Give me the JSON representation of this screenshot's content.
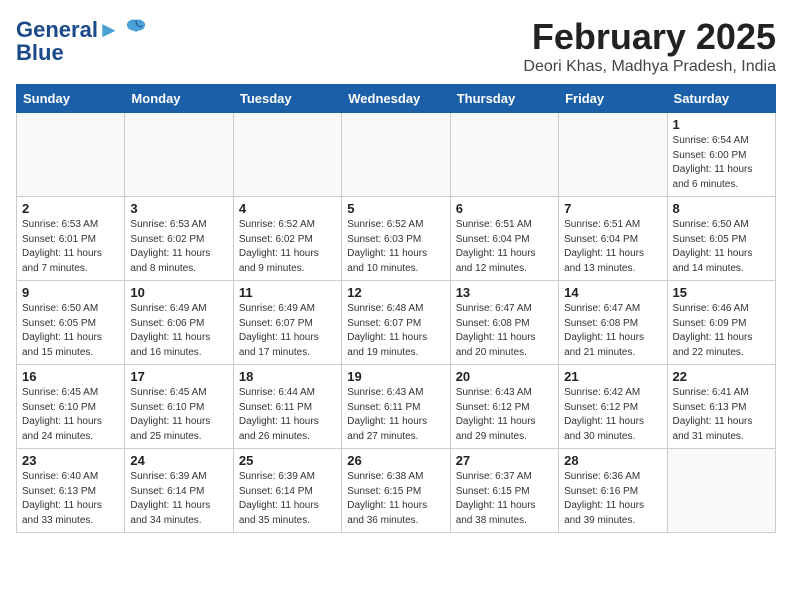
{
  "header": {
    "logo_line1": "General",
    "logo_line2": "Blue",
    "title": "February 2025",
    "subtitle": "Deori Khas, Madhya Pradesh, India"
  },
  "weekdays": [
    "Sunday",
    "Monday",
    "Tuesday",
    "Wednesday",
    "Thursday",
    "Friday",
    "Saturday"
  ],
  "weeks": [
    [
      {
        "day": "",
        "info": ""
      },
      {
        "day": "",
        "info": ""
      },
      {
        "day": "",
        "info": ""
      },
      {
        "day": "",
        "info": ""
      },
      {
        "day": "",
        "info": ""
      },
      {
        "day": "",
        "info": ""
      },
      {
        "day": "1",
        "info": "Sunrise: 6:54 AM\nSunset: 6:00 PM\nDaylight: 11 hours\nand 6 minutes."
      }
    ],
    [
      {
        "day": "2",
        "info": "Sunrise: 6:53 AM\nSunset: 6:01 PM\nDaylight: 11 hours\nand 7 minutes."
      },
      {
        "day": "3",
        "info": "Sunrise: 6:53 AM\nSunset: 6:02 PM\nDaylight: 11 hours\nand 8 minutes."
      },
      {
        "day": "4",
        "info": "Sunrise: 6:52 AM\nSunset: 6:02 PM\nDaylight: 11 hours\nand 9 minutes."
      },
      {
        "day": "5",
        "info": "Sunrise: 6:52 AM\nSunset: 6:03 PM\nDaylight: 11 hours\nand 10 minutes."
      },
      {
        "day": "6",
        "info": "Sunrise: 6:51 AM\nSunset: 6:04 PM\nDaylight: 11 hours\nand 12 minutes."
      },
      {
        "day": "7",
        "info": "Sunrise: 6:51 AM\nSunset: 6:04 PM\nDaylight: 11 hours\nand 13 minutes."
      },
      {
        "day": "8",
        "info": "Sunrise: 6:50 AM\nSunset: 6:05 PM\nDaylight: 11 hours\nand 14 minutes."
      }
    ],
    [
      {
        "day": "9",
        "info": "Sunrise: 6:50 AM\nSunset: 6:05 PM\nDaylight: 11 hours\nand 15 minutes."
      },
      {
        "day": "10",
        "info": "Sunrise: 6:49 AM\nSunset: 6:06 PM\nDaylight: 11 hours\nand 16 minutes."
      },
      {
        "day": "11",
        "info": "Sunrise: 6:49 AM\nSunset: 6:07 PM\nDaylight: 11 hours\nand 17 minutes."
      },
      {
        "day": "12",
        "info": "Sunrise: 6:48 AM\nSunset: 6:07 PM\nDaylight: 11 hours\nand 19 minutes."
      },
      {
        "day": "13",
        "info": "Sunrise: 6:47 AM\nSunset: 6:08 PM\nDaylight: 11 hours\nand 20 minutes."
      },
      {
        "day": "14",
        "info": "Sunrise: 6:47 AM\nSunset: 6:08 PM\nDaylight: 11 hours\nand 21 minutes."
      },
      {
        "day": "15",
        "info": "Sunrise: 6:46 AM\nSunset: 6:09 PM\nDaylight: 11 hours\nand 22 minutes."
      }
    ],
    [
      {
        "day": "16",
        "info": "Sunrise: 6:45 AM\nSunset: 6:10 PM\nDaylight: 11 hours\nand 24 minutes."
      },
      {
        "day": "17",
        "info": "Sunrise: 6:45 AM\nSunset: 6:10 PM\nDaylight: 11 hours\nand 25 minutes."
      },
      {
        "day": "18",
        "info": "Sunrise: 6:44 AM\nSunset: 6:11 PM\nDaylight: 11 hours\nand 26 minutes."
      },
      {
        "day": "19",
        "info": "Sunrise: 6:43 AM\nSunset: 6:11 PM\nDaylight: 11 hours\nand 27 minutes."
      },
      {
        "day": "20",
        "info": "Sunrise: 6:43 AM\nSunset: 6:12 PM\nDaylight: 11 hours\nand 29 minutes."
      },
      {
        "day": "21",
        "info": "Sunrise: 6:42 AM\nSunset: 6:12 PM\nDaylight: 11 hours\nand 30 minutes."
      },
      {
        "day": "22",
        "info": "Sunrise: 6:41 AM\nSunset: 6:13 PM\nDaylight: 11 hours\nand 31 minutes."
      }
    ],
    [
      {
        "day": "23",
        "info": "Sunrise: 6:40 AM\nSunset: 6:13 PM\nDaylight: 11 hours\nand 33 minutes."
      },
      {
        "day": "24",
        "info": "Sunrise: 6:39 AM\nSunset: 6:14 PM\nDaylight: 11 hours\nand 34 minutes."
      },
      {
        "day": "25",
        "info": "Sunrise: 6:39 AM\nSunset: 6:14 PM\nDaylight: 11 hours\nand 35 minutes."
      },
      {
        "day": "26",
        "info": "Sunrise: 6:38 AM\nSunset: 6:15 PM\nDaylight: 11 hours\nand 36 minutes."
      },
      {
        "day": "27",
        "info": "Sunrise: 6:37 AM\nSunset: 6:15 PM\nDaylight: 11 hours\nand 38 minutes."
      },
      {
        "day": "28",
        "info": "Sunrise: 6:36 AM\nSunset: 6:16 PM\nDaylight: 11 hours\nand 39 minutes."
      },
      {
        "day": "",
        "info": ""
      }
    ]
  ]
}
